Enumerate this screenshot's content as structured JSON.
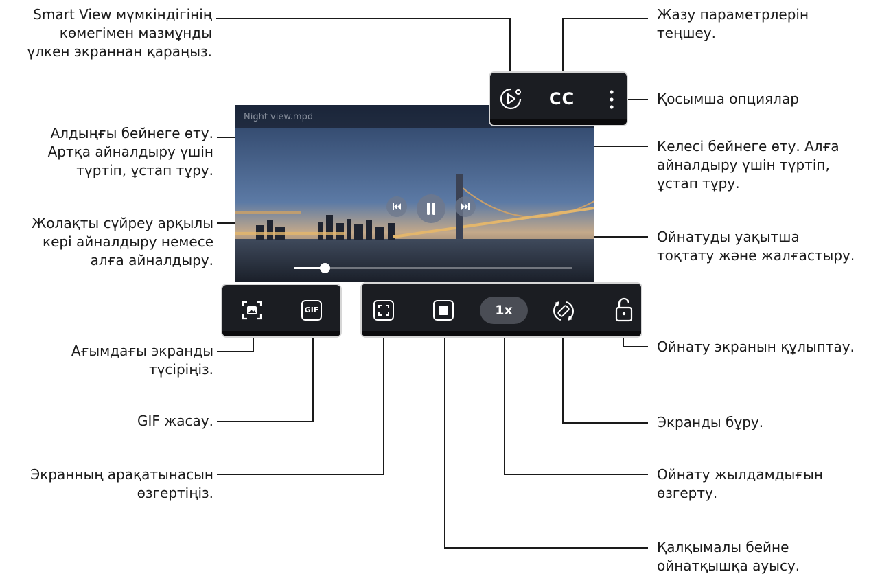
{
  "video": {
    "file_name": "Night view.mpd",
    "progress": 0.11
  },
  "top_bar": {
    "cc_label": "CC"
  },
  "bottom_bar": {
    "speed_label": "1x",
    "gif_label": "GIF"
  },
  "labels": {
    "smart_view": "Smart View мүмкіндігінің\nкөмегімен мазмұнды\nүлкен экраннан қараңыз.",
    "previous": "Алдыңғы бейнеге өту.\nАртқа айналдыру үшін\nтүртіп, ұстап тұру.",
    "seek_bar": "Жолақты сүйреу арқылы\nкері айналдыру немесе\nалға айналдыру.",
    "capture": "Ағымдағы экранды\nтүсіріңіз.",
    "gif": "GIF жасау.",
    "ratio": "Экранның арақатынасын\nөзгертіңіз.",
    "subtitles": "Жазу параметрлерін\nтеңшеу.",
    "more": "Қосымша опциялар",
    "next": "Келесі бейнеге өту. Алға\nайналдыру үшін түртіп,\nұстап тұру.",
    "pause": "Ойнатуды уақытша\nтоқтату және жалғастыру.",
    "lock": "Ойнату экранын құлыптау.",
    "rotate": "Экранды бұру.",
    "speed": "Ойнату жылдамдығын\nөзгерту.",
    "popup": "Қалқымалы бейне\nойнатқышқа ауысу."
  },
  "colors": {
    "callout_line": "#1a1a1a",
    "box_border": "#d6d6d6",
    "control_bg": "#1b1d22"
  }
}
